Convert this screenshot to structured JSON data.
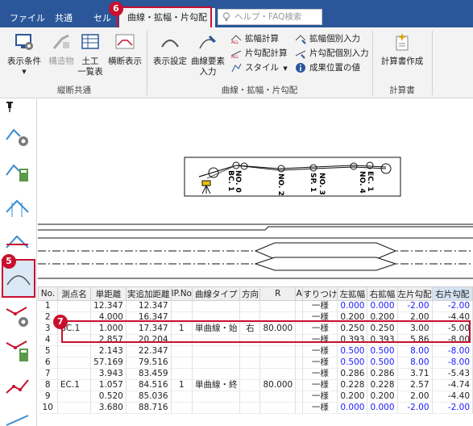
{
  "tabs": [
    "ファイル",
    "共通",
    "セル",
    "曲線・拡幅・片勾配"
  ],
  "help_search": {
    "placeholder": "ヘルプ・FAQ検索"
  },
  "ribbon": {
    "display_condition": "表示条件",
    "structure": "構造物",
    "earthwork_list": [
      "土工",
      "一覧表"
    ],
    "cross_display": "横断表示",
    "display_settings": "表示設定",
    "curve_input": [
      "曲線要素",
      "入力"
    ],
    "widen_calc": "拡幅計算",
    "superelev_calc": "片勾配計算",
    "style": "スタイル",
    "widen_individual": "拡幅個別入力",
    "superelev_individual": "片勾配個別入力",
    "result_value": "成果位置の値",
    "report_create": "計算書作成",
    "group_common": "縦断共通",
    "group_curve": "曲線・拡幅・片勾配",
    "group_report": "計算書"
  },
  "plan_labels": [
    "NO. 0",
    "BC. 1",
    "NO. 2",
    "SP. 1",
    "NO. 3",
    "EC. 1",
    "NO. 4"
  ],
  "table": {
    "headers": [
      "No.",
      "測点名",
      "単距離",
      "実追加距離",
      "IP.No",
      "曲線タイプ",
      "方向",
      "R",
      "A",
      "すりつけ",
      "左拡幅",
      "右拡幅",
      "左片勾配",
      "右片勾配"
    ],
    "rows": [
      [
        "1",
        "",
        "12.347",
        "12.347",
        "",
        "",
        "",
        "",
        "",
        "一様",
        "0.000",
        "0.000",
        "-2.00",
        "-2.00"
      ],
      [
        "2",
        "",
        "4.000",
        "16.347",
        "",
        "",
        "",
        "",
        "",
        "一様",
        "0.200",
        "0.200",
        "2.00",
        "-4.40"
      ],
      [
        "3",
        "BC.1",
        "1.000",
        "17.347",
        "1",
        "単曲線・始",
        "右",
        "80.000",
        "",
        "一様",
        "0.250",
        "0.250",
        "3.00",
        "-5.00"
      ],
      [
        "4",
        "",
        "2.857",
        "20.204",
        "",
        "",
        "",
        "",
        "",
        "一様",
        "0.393",
        "0.393",
        "5.86",
        "-8.00"
      ],
      [
        "5",
        "",
        "2.143",
        "22.347",
        "",
        "",
        "",
        "",
        "",
        "一様",
        "0.500",
        "0.500",
        "8.00",
        "-8.00"
      ],
      [
        "6",
        "",
        "57.169",
        "79.516",
        "",
        "",
        "",
        "",
        "",
        "一様",
        "0.500",
        "0.500",
        "8.00",
        "-8.00"
      ],
      [
        "7",
        "",
        "3.943",
        "83.459",
        "",
        "",
        "",
        "",
        "",
        "一様",
        "0.286",
        "0.286",
        "3.71",
        "-5.43"
      ],
      [
        "8",
        "EC.1",
        "1.057",
        "84.516",
        "1",
        "単曲線・終",
        "",
        "80.000",
        "",
        "一様",
        "0.228",
        "0.228",
        "2.57",
        "-4.74"
      ],
      [
        "9",
        "",
        "0.520",
        "85.036",
        "",
        "",
        "",
        "",
        "",
        "一様",
        "0.200",
        "0.200",
        "2.00",
        "-4.40"
      ],
      [
        "10",
        "",
        "3.680",
        "88.716",
        "",
        "",
        "",
        "",
        "",
        "一様",
        "0.000",
        "0.000",
        "-2.00",
        "-2.00"
      ]
    ]
  },
  "badges": {
    "b5": "5",
    "b6": "6",
    "b7": "7"
  },
  "colors": {
    "titlebar": "#2b579a",
    "ribbon": "#f3f3f3",
    "badge": "#c8102e",
    "blue_value": "#1a1aff"
  }
}
